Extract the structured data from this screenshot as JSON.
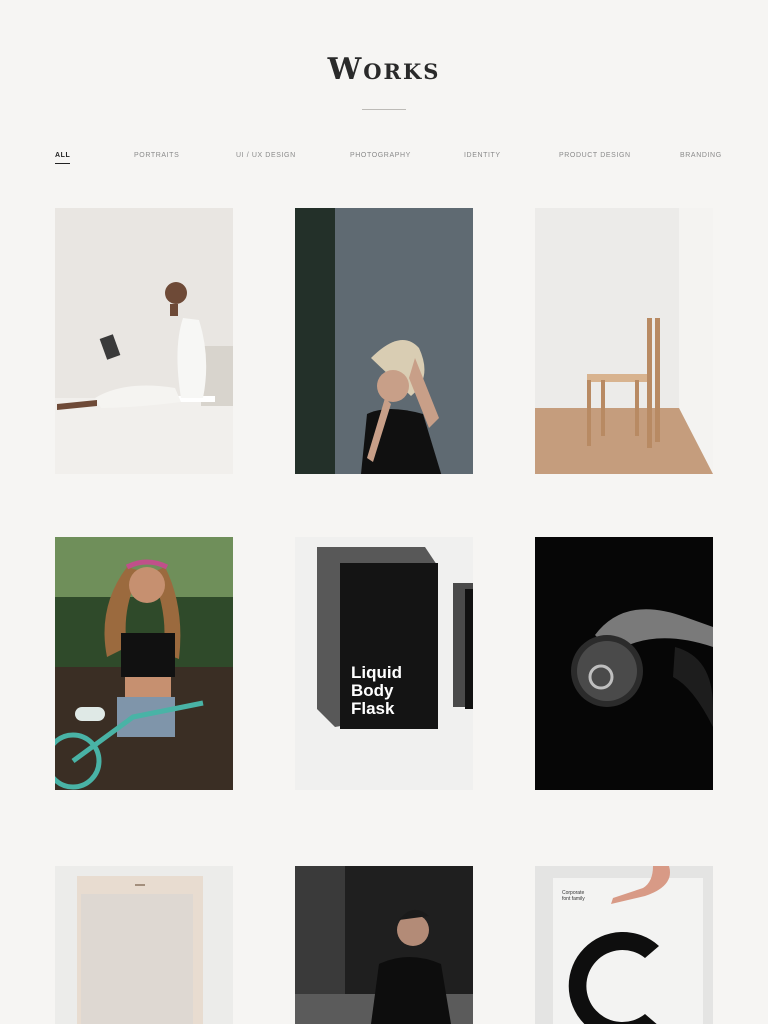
{
  "header": {
    "title": "Works"
  },
  "filters": [
    {
      "label": "All",
      "active": true
    },
    {
      "label": "Portraits"
    },
    {
      "label": "UI / UX Design"
    },
    {
      "label": "Photography"
    },
    {
      "label": "Identity"
    },
    {
      "label": "Product Design"
    },
    {
      "label": "Branding"
    }
  ],
  "gallery": {
    "flask": {
      "line1": "Liquid",
      "line2": "Body",
      "line3": "Flask"
    },
    "poster": {
      "line1": "Corporate",
      "line2": "font family"
    }
  }
}
